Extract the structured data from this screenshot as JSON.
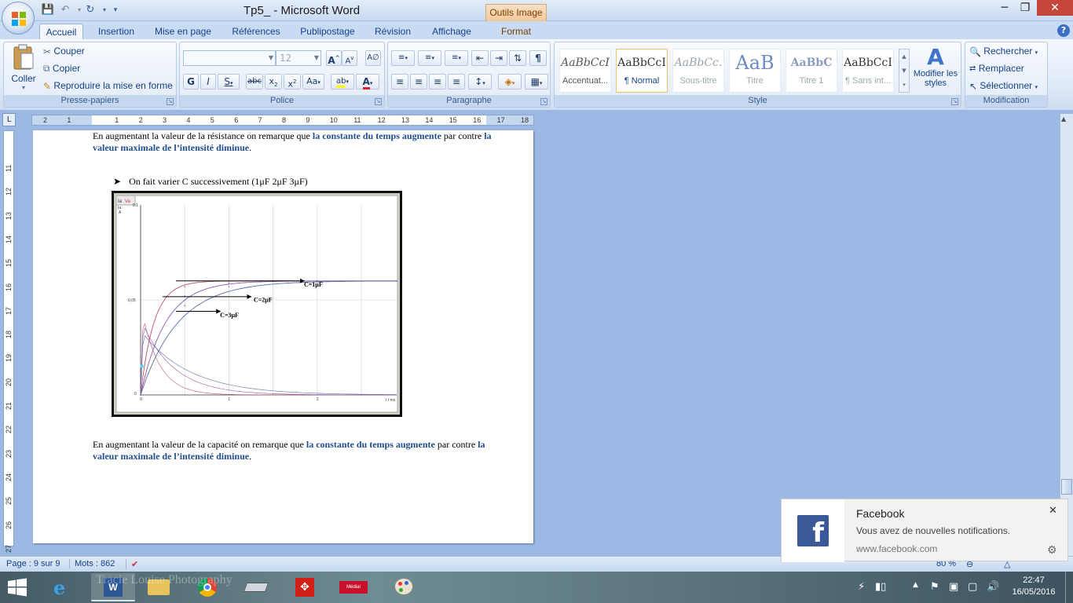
{
  "window": {
    "title": "Tp5_  - Microsoft Word",
    "context_tab": "Outils Image"
  },
  "tabs": [
    "Accueil",
    "Insertion",
    "Mise en page",
    "Références",
    "Publipostage",
    "Révision",
    "Affichage",
    "Format"
  ],
  "active_tab": "Accueil",
  "ribbon": {
    "clipboard": {
      "paste": "Coller",
      "cut": "Couper",
      "copy": "Copier",
      "format_painter": "Reproduire la mise en forme",
      "label": "Presse-papiers"
    },
    "font": {
      "font_name": "",
      "font_size": "12",
      "label": "Police"
    },
    "paragraph": {
      "label": "Paragraphe"
    },
    "styles": {
      "items": [
        {
          "sample": "AaBbCcI",
          "name": "Accentuat..."
        },
        {
          "sample": "AaBbCcI",
          "name": "¶ Normal"
        },
        {
          "sample": "AaBbCc.",
          "name": "Sous-titre"
        },
        {
          "sample": "AaB",
          "name": "Titre"
        },
        {
          "sample": "AaBbC",
          "name": "Titre 1"
        },
        {
          "sample": "AaBbCcI",
          "name": "¶ Sans int..."
        }
      ],
      "change_styles": "Modifier les styles",
      "label": "Style"
    },
    "editing": {
      "find": "Rechercher",
      "replace": "Remplacer",
      "select": "Sélectionner",
      "label": "Modification"
    }
  },
  "ruler": {
    "numbers": [
      "2",
      "1",
      "",
      "1",
      "2",
      "3",
      "4",
      "5",
      "6",
      "7",
      "8",
      "9",
      "10",
      "11",
      "12",
      "13",
      "14",
      "15",
      "16",
      "17",
      "18"
    ],
    "vertical_numbers": [
      "11",
      "12",
      "13",
      "14",
      "15",
      "16",
      "17",
      "18",
      "19",
      "20",
      "21",
      "22",
      "23",
      "24",
      "25",
      "26",
      "27"
    ]
  },
  "document": {
    "para1": {
      "t1": "En augmentant la valeur de la résistance on remarque que ",
      "h1": "la constante du temps augmente",
      "t2": " par contre ",
      "h2": "la valeur maximale de l’intensité diminue",
      "t3": "."
    },
    "bullet": "On fait varier C successivement (1μF  2μF  3μF)",
    "figure": {
      "tab1": "Ia",
      "tab2": "Va",
      "unit_i": "Ia",
      "unit_a": "A",
      "y_top": "0.1",
      "y_mid": "0,05",
      "y_zero": "0",
      "x1": "1",
      "x2": "2",
      "x_unit": "t / ms",
      "labels": [
        "C=1μF",
        "C=2μF",
        "C=3μF"
      ]
    },
    "para2": {
      "t1": "En augmentant la valeur de la capacité on remarque que ",
      "h1": "la constante du temps augmente",
      "t2": " par contre ",
      "h2": "la valeur maximale de l’intensité diminue",
      "t3": "."
    }
  },
  "chart_data": {
    "type": "line",
    "x": [
      0,
      0.5,
      1,
      1.5,
      2,
      2.9
    ],
    "series": [
      {
        "name": "C=1μF",
        "values": [
          0,
          0.057,
          0.06,
          0.06,
          0.06,
          0.06
        ]
      },
      {
        "name": "C=2μF",
        "values": [
          0,
          0.052,
          0.059,
          0.06,
          0.06,
          0.06
        ]
      },
      {
        "name": "C=3μF",
        "values": [
          0,
          0.047,
          0.057,
          0.06,
          0.06,
          0.06
        ]
      }
    ],
    "xlabel": "t / ms",
    "ylabel": "",
    "ylim": [
      0,
      0.1
    ],
    "xlim": [
      0,
      2.9
    ],
    "grid": true
  },
  "status": {
    "page": "Page : 9 sur 9",
    "words": "Mots : 862",
    "zoom": "80 %"
  },
  "toast": {
    "app": "Facebook",
    "message": "Vous avez de nouvelles notifications.",
    "source": "www.facebook.com"
  },
  "taskbar": {
    "time": "22:47",
    "date": "16/05/2016",
    "wallpaper_text": "Tracie Louise Photography"
  }
}
